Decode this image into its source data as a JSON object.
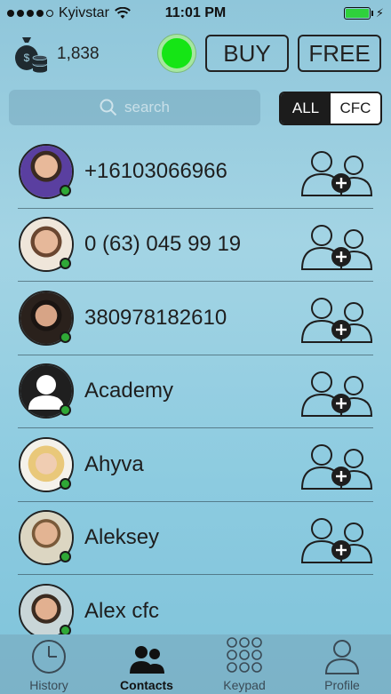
{
  "status_bar": {
    "carrier": "Kyivstar",
    "time": "11:01 PM"
  },
  "header": {
    "credits": "1,838",
    "buy_label": "BUY",
    "free_label": "FREE",
    "status_color": "#15e515"
  },
  "search": {
    "placeholder": "search"
  },
  "filter": {
    "all_label": "ALL",
    "cfc_label": "CFC",
    "selected": "ALL"
  },
  "contacts": [
    {
      "name": "+16103066966",
      "avatar": "photo",
      "online": true
    },
    {
      "name": "0 (63) 045 99 19",
      "avatar": "photo",
      "online": true
    },
    {
      "name": "380978182610",
      "avatar": "photo",
      "online": true
    },
    {
      "name": "Academy",
      "avatar": "default-person-icon",
      "online": true
    },
    {
      "name": "Ahyva",
      "avatar": "photo",
      "online": true
    },
    {
      "name": "Aleksey",
      "avatar": "photo",
      "online": true
    },
    {
      "name": "Alex cfc",
      "avatar": "photo",
      "online": true
    }
  ],
  "tabs": [
    {
      "label": "History",
      "icon": "clock-icon"
    },
    {
      "label": "Contacts",
      "icon": "people-icon",
      "active": true
    },
    {
      "label": "Keypad",
      "icon": "keypad-icon"
    },
    {
      "label": "Profile",
      "icon": "person-icon"
    }
  ],
  "colors": {
    "online": "#2fa836",
    "accent_dark": "#1c1c1c",
    "battery": "#2fd13c"
  }
}
